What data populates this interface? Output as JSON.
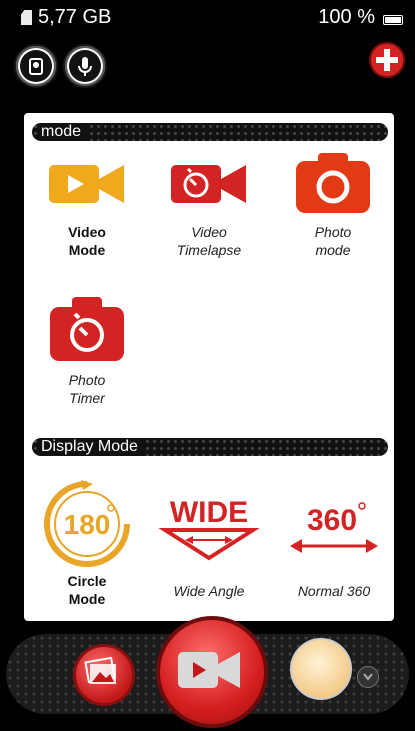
{
  "status_bar": {
    "storage": "5,77 GB",
    "battery": "100 %"
  },
  "mode_section": {
    "title": "mode",
    "items": [
      {
        "label": "Video\nMode",
        "icon": "video-camera-icon",
        "active": true
      },
      {
        "label": "Video\nTimelapse",
        "icon": "timelapse-icon",
        "active": false
      },
      {
        "label": "Photo\nmode",
        "icon": "photo-camera-icon",
        "active": false
      },
      {
        "label": "Photo\nTimer",
        "icon": "photo-timer-icon",
        "active": false
      }
    ]
  },
  "display_section": {
    "title": "Display Mode",
    "items": [
      {
        "label": "Circle\nMode",
        "icon_text": "180",
        "icon": "circle-180-icon",
        "active": true
      },
      {
        "label": "Wide Angle",
        "icon_text": "WIDE",
        "icon": "wide-angle-icon",
        "active": false
      },
      {
        "label": "Normal 360",
        "icon_text": "360",
        "icon": "normal-360-icon",
        "active": false
      }
    ]
  },
  "colors": {
    "accent_red": "#d42323",
    "accent_orange": "#f0a81c",
    "panel_bg": "#ffffff"
  }
}
